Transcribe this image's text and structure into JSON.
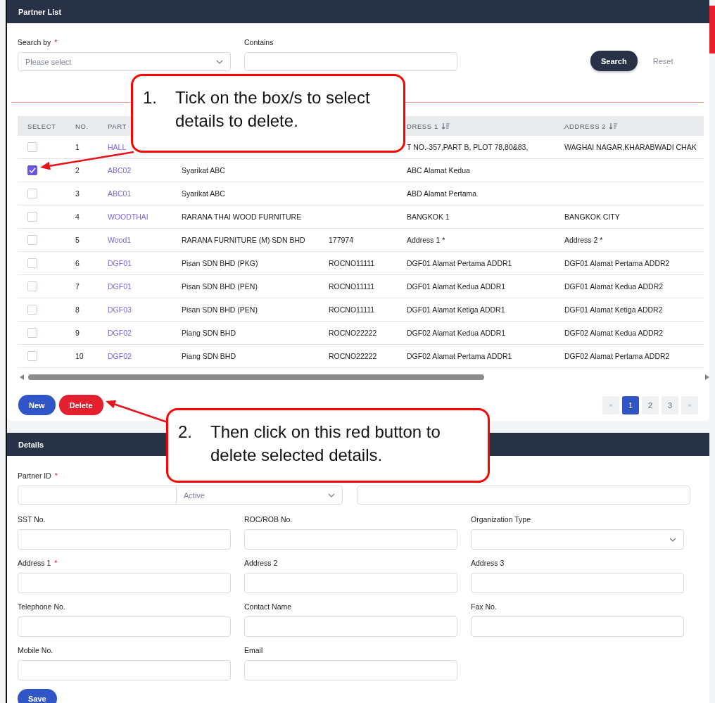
{
  "partner_list": {
    "title": "Partner List",
    "search_by": {
      "label": "Search by",
      "required_mark": "*",
      "placeholder": "Please select"
    },
    "contains": {
      "label": "Contains"
    },
    "search_button": "Search",
    "reset_button": "Reset"
  },
  "table": {
    "headers": {
      "select": "SELECT",
      "no": "NO.",
      "partner_id": "PART",
      "address_1": "DRESS 1",
      "address_2": "ADDRESS 2"
    },
    "rows": [
      {
        "checked": false,
        "no": "1",
        "partner_id": "HALL",
        "address_1": "T NO.-357,PART B, PLOT 78,80&83,",
        "address_2": "WAGHAI NAGAR,KHARABWADI CHAK"
      },
      {
        "checked": true,
        "no": "2",
        "partner_id": "ABC02",
        "name": "Syarikat ABC",
        "address_1": "ABC Alamat Kedua"
      },
      {
        "checked": false,
        "no": "3",
        "partner_id": "ABC01",
        "name": "Syarikat ABC",
        "address_1": "ABD Alamat Pertama"
      },
      {
        "checked": false,
        "no": "4",
        "partner_id": "WOODTHAI",
        "name": "RARANA THAI WOOD FURNITURE",
        "address_1": "BANGKOK 1",
        "address_2": "BANGKOK CITY"
      },
      {
        "checked": false,
        "no": "5",
        "partner_id": "Wood1",
        "name": "RARANA FURNITURE (M) SDN BHD",
        "roc": "177974",
        "address_1": "Address 1 *",
        "address_2": "Address 2 *"
      },
      {
        "checked": false,
        "no": "6",
        "partner_id": "DGF01",
        "name": "Pisan SDN BHD (PKG)",
        "roc": "ROCNO11111",
        "address_1": "DGF01 Alamat Pertama ADDR1",
        "address_2": "DGF01 Alamat Pertama ADDR2"
      },
      {
        "checked": false,
        "no": "7",
        "partner_id": "DGF01",
        "name": "Pisan SDN BHD (PEN)",
        "roc": "ROCNO11111",
        "address_1": "DGF01 Alamat Kedua ADDR1",
        "address_2": "DGF01 Alamat Kedua ADDR2"
      },
      {
        "checked": false,
        "no": "8",
        "partner_id": "DGF03",
        "name": "Pisan SDN BHD (PEN)",
        "roc": "ROCNO11111",
        "address_1": "DGF01 Alamat Ketiga ADDR1",
        "address_2": "DGF01 Alamat Ketiga ADDR2"
      },
      {
        "checked": false,
        "no": "9",
        "partner_id": "DGF02",
        "name": "Piang SDN BHD",
        "roc": "ROCNO22222",
        "address_1": "DGF02 Alamat Kedua ADDR1",
        "address_2": "DGF02 Alamat Kedua ADDR2"
      },
      {
        "checked": false,
        "no": "10",
        "partner_id": "DGF02",
        "name": "Piang SDN BHD",
        "roc": "ROCNO22222",
        "address_1": "DGF02 Alamat Pertama ADDR1",
        "address_2": "DGF02 Alamat Pertama ADDR2"
      }
    ]
  },
  "actions": {
    "new_button": "New",
    "delete_button": "Delete"
  },
  "pagination": {
    "prev": "«",
    "pages": [
      {
        "label": "1",
        "selected": true
      },
      {
        "label": "2",
        "selected": false
      },
      {
        "label": "3",
        "selected": false
      }
    ],
    "next": "»"
  },
  "details": {
    "title": "Details",
    "id_row": {
      "label": "Partner ID",
      "required_mark": "*",
      "status_placeholder": "Active"
    },
    "fields": [
      {
        "label": "SST No.",
        "kind": "input"
      },
      {
        "label": "ROC/ROB No.",
        "kind": "input"
      },
      {
        "label": "Organization Type",
        "kind": "select"
      },
      {
        "label": "Address 1",
        "required_mark": "*",
        "kind": "input"
      },
      {
        "label": "Address 2",
        "kind": "input"
      },
      {
        "label": "Address 3",
        "kind": "input"
      },
      {
        "label": "Telephone No.",
        "kind": "input"
      },
      {
        "label": "Contact Name",
        "kind": "input"
      },
      {
        "label": "Fax No.",
        "kind": "input"
      },
      {
        "label": "Mobile No.",
        "kind": "input"
      },
      {
        "label": "Email",
        "kind": "input"
      }
    ],
    "save_button": "Save"
  },
  "callouts": [
    {
      "number": "1.",
      "text": "Tick on the box/s to select details to delete."
    },
    {
      "number": "2.",
      "text": "Then click on this red button to delete selected details."
    }
  ]
}
